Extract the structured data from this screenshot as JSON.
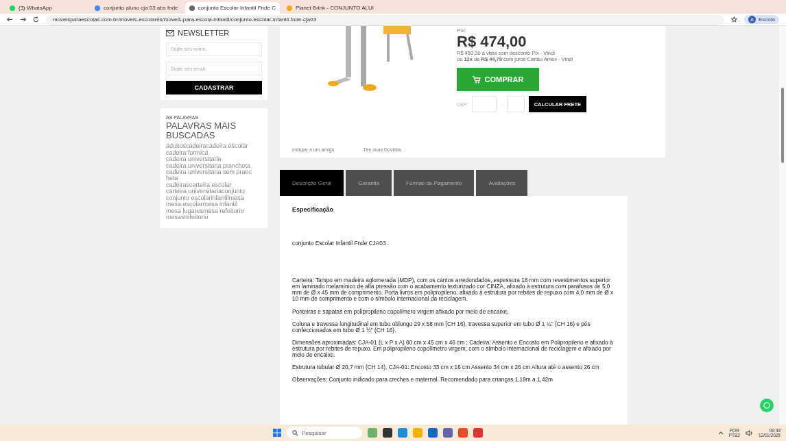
{
  "browser": {
    "tabs": [
      {
        "title": "(3) WhatsApp",
        "selected": false
      },
      {
        "title": "conjunto aluno cja 03 abs fnde",
        "selected": false
      },
      {
        "title": "conjunto Escolar Infantil Fnde C",
        "selected": true
      },
      {
        "title": "Planet Brink - CONJUNTO ALUI",
        "selected": false
      }
    ],
    "url": "moveisparaescolas.com.br/moveis-escolares/moveis-para-escola-infantil/conjunto-escolar-infantil-fnde-cja03",
    "profile": "Escola",
    "profile_initial": "A"
  },
  "sidebar": {
    "newsletter": {
      "title": "NEWSLETTER",
      "name_placeholder": "Digite seu nome.",
      "email_placeholder": "Digite seu email.",
      "button": "CADASTRAR"
    },
    "keywords": {
      "kicker": "AS PALAVRAS",
      "title": "PALAVRAS MAIS BUSCADAS",
      "items": [
        "adultoscadeiracadeira escolar",
        "cadeira formica",
        "cadeira universitaria",
        "cadeira universitaria prancheta",
        "cadeira universitaria sem pranc heta",
        "cadeirascarteira escolar",
        "carteira universitariaconjunto",
        "conjunto escolarinfantilmesa",
        "mesa escolarmesa infantil",
        "mesa lugaresmesa refeitorio",
        "mesasrefeitorio"
      ]
    }
  },
  "product": {
    "price_label": "Por:",
    "price": "R$ 474,00",
    "pix_line": "R$ 450,30 à vista com desconto Pix - Vindi",
    "installments": "ou **12x** de **R$ 44,79** com juros Cartão Amex - Vindi",
    "buy_button": "COMPRAR",
    "cep_label": "CEP:",
    "cep_separator": "-",
    "shipping_button": "CALCULAR FRETE",
    "links": [
      "Indique a um amigo",
      "Tire suas Dúvidas"
    ]
  },
  "tabs": [
    {
      "label": "Descrição Geral",
      "selected": true
    },
    {
      "label": "Garantia",
      "selected": false
    },
    {
      "label": "Formas de Pagamento",
      "selected": false
    },
    {
      "label": "Avaliações",
      "selected": false
    }
  ],
  "description": {
    "heading": "Especificação",
    "intro": "conjunto Escolar Infantil Fnde CJA03 .",
    "paragraphs": [
      "Carteira: Tampo em madeira aglomerada (MDP), com os cantos arredondados, espessura 18 mm com revestimentos superior em laminado melamínico de alta pressão com o acabamento texturizado cor CINZA, afixado à estrutura com parafusos de 5,0 mm de Ø x 45 mm de comprimento. Porta livros em polipropileno, afixado à estrutura por rebites de repuxo com 4,0 mm de Ø x 10 mm de comprimento e com o símbolo internacional da reciclagem.",
      "Ponteiras e sapatas em polipropileno copolímero virgem afixado por meio de encaixe.",
      "Coluna e travessa longitudinal em tubo oblongo 29 x 58 mm (CH 16), travessa superior em tubo Ø 1 ¼\" (CH 16) e pés confeccionados em tubo Ø 1 ½\" (CH 16).",
      "Dimensões aproximadas: CJA-01 (L x P x A) 60 cm x 45 cm x 46 cm ; Cadeira: Assento e Encosto em Polipropileno e afixado à estrutura por rebites de repuxo. Em polipropileno copolímetro virgem, com o símbolo internacional de reciclagem e afixado por meio de encaixe.",
      "Estrutura tubular Ø 20,7 mm (CH 14). CJA-01: Encosto 33 cm x 16 cm Assento 34 cm x 26 cm Altura até o assento 26 cm",
      "Observações: Conjunto indicado para creches e maternal. Recomendado para crianças 1,19m a 1,42m"
    ]
  },
  "taskbar": {
    "search_placeholder": "Pesquisar",
    "language": "POR",
    "layout": "PTB2",
    "time": "09:43",
    "date": "12/11/2025"
  }
}
